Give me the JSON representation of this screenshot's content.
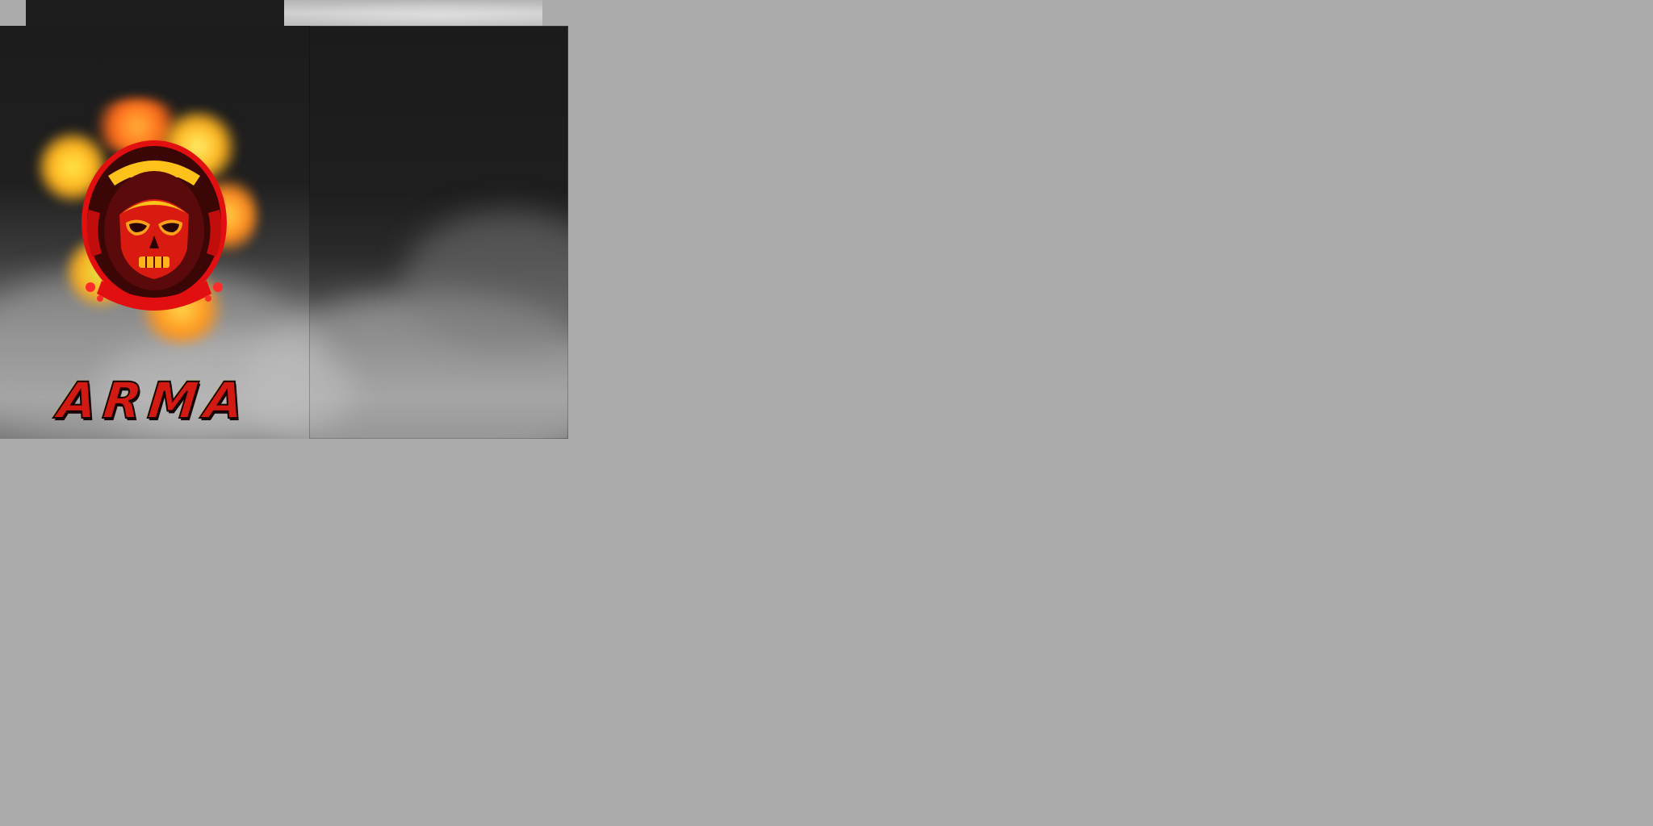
{
  "texture": {
    "logo_text": "ARMA",
    "colors": {
      "background": "#ababab",
      "panel_dark": "#1c1c1c",
      "fog": "#b0b0b0",
      "emblem_red": "#e10f0f",
      "emblem_dark": "#3a0606",
      "emblem_yellow": "#ffc21a",
      "fire_yellow": "#ffe94a",
      "fire_orange": "#ff8a1f"
    },
    "emblem_icon": "skull-astronaut-helmet-icon"
  }
}
